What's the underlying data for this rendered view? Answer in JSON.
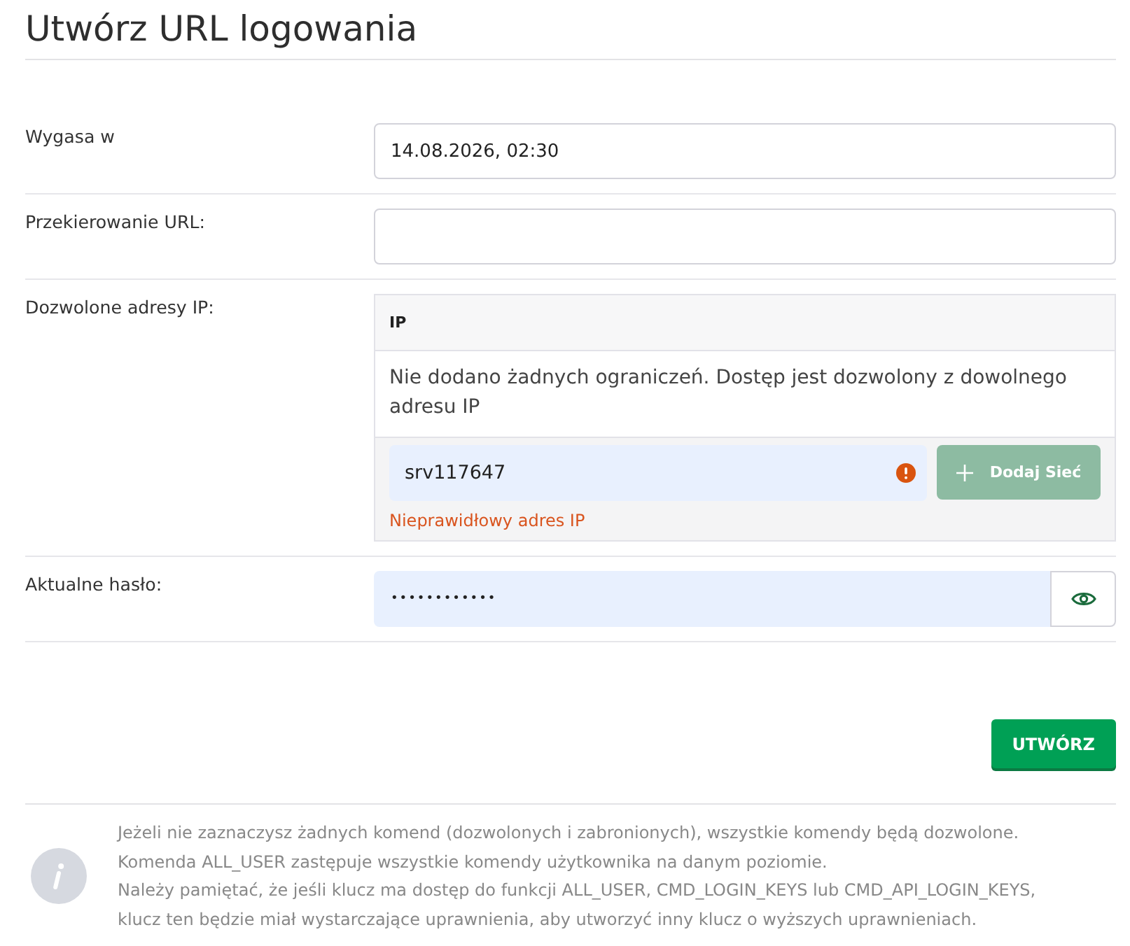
{
  "title": "Utwórz URL logowania",
  "fields": [
    {
      "kind": "text",
      "label": "Wygasa w",
      "value": "14.08.2026, 02:30"
    },
    {
      "kind": "text",
      "label": "Przekierowanie URL:"
    },
    {
      "kind": "ip_list",
      "label": "Dozwolone adresy IP:",
      "header": "IP",
      "empty_message": "Nie dodano żadnych ograniczeń. Dostęp jest dozwolony z dowolnego adresu IP",
      "input_value": "srv117647",
      "error": "Nieprawidłowy adres IP",
      "add_button": {
        "label": "Dodaj Sieć",
        "disabled": true
      }
    },
    {
      "kind": "password",
      "label": "Aktualne hasło:",
      "value": "••••••••••••"
    }
  ],
  "submit": {
    "label": "UTWÓRZ"
  },
  "info": {
    "lines": [
      "Jeżeli nie zaznaczysz żadnych komend (dozwolonych i zabronionych), wszystkie komendy będą dozwolone.",
      "Komenda ALL_USER zastępuje wszystkie komendy użytkownika na danym poziomie.",
      "Należy pamiętać, że jeśli klucz ma dostęp do funkcji ALL_USER, CMD_LOGIN_KEYS lub CMD_API_LOGIN_KEYS, klucz ten będzie miał wystarczające uprawnienia, aby utworzyć inny klucz o wyższych uprawnieniach."
    ]
  }
}
